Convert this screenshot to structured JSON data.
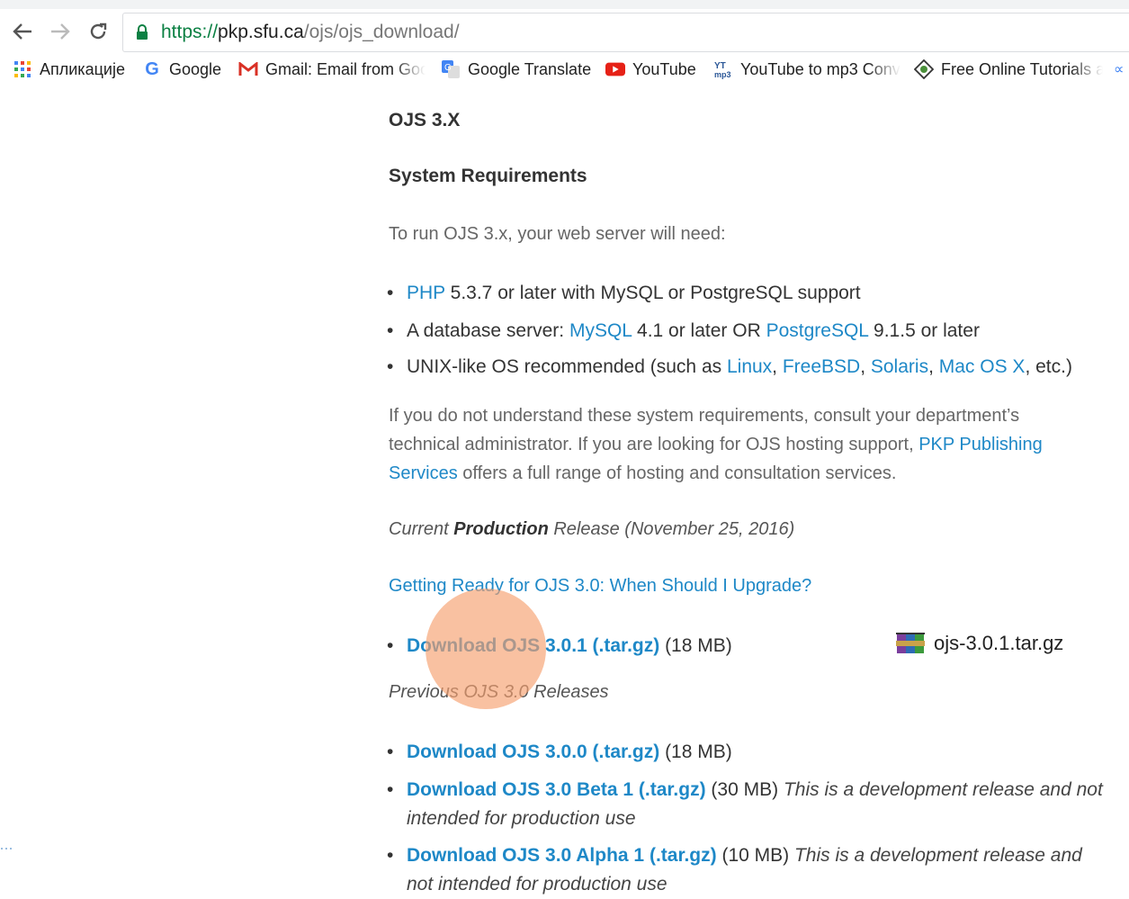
{
  "browser": {
    "url": {
      "scheme": "https://",
      "host": "pkp.sfu.ca",
      "path": "/ojs/ojs_download/"
    },
    "bookmarks": [
      {
        "label": "Апликације",
        "icon": "apps-grid-icon"
      },
      {
        "label": "Google",
        "icon": "google-g-icon"
      },
      {
        "label": "Gmail: Email from Goo",
        "icon": "gmail-icon"
      },
      {
        "label": "Google Translate",
        "icon": "google-translate-icon"
      },
      {
        "label": "YouTube",
        "icon": "youtube-icon"
      },
      {
        "label": "YouTube to mp3 Conv",
        "icon": "yt-mp3-icon"
      },
      {
        "label": "Free Online Tutorials a",
        "icon": "tutorials-icon"
      }
    ]
  },
  "page": {
    "section_title": "OJS 3.X",
    "requirements_title": "System Requirements",
    "intro": "To run OJS 3.x, your web server will need:",
    "requirements": {
      "php": {
        "link": "PHP",
        "text": " 5.3.7 or later with MySQL or PostgreSQL support"
      },
      "db": {
        "pre": "A database server: ",
        "link1": "MySQL",
        "mid": " 4.1 or later OR ",
        "link2": "PostgreSQL",
        "post": " 9.1.5 or later"
      },
      "os": {
        "pre": "UNIX-like OS recommended (such as ",
        "links": [
          "Linux",
          "FreeBSD",
          "Solaris",
          "Mac OS X"
        ],
        "sep": ", ",
        "post": ", etc.)"
      }
    },
    "consult": {
      "line1": "If you do not understand these system requirements, consult your department’s",
      "line2_pre": "technical administrator. If you are looking for OJS hosting support, ",
      "link_a": "PKP Publishing",
      "link_b": "Services",
      "line3_post": " offers a full range of hosting and consultation services."
    },
    "current_release": {
      "pre": "Current ",
      "bold": "Production",
      "post": " Release (November 25, 2016)"
    },
    "upgrade_link": "Getting Ready for OJS 3.0: When Should I Upgrade?",
    "current_download": {
      "link": "Download OJS 3.0.1 (.tar.gz)",
      "size": " (18 MB)"
    },
    "downloaded_file": {
      "name": "ojs-3.0.1.tar.gz",
      "icon": "winrar-archive-icon"
    },
    "previous_title": "Previous OJS 3.0 Releases",
    "previous": [
      {
        "link": "Download OJS 3.0.0 (.tar.gz)",
        "size": " (18 MB)",
        "note1": "",
        "note2": ""
      },
      {
        "link": "Download OJS 3.0 Beta 1 (.tar.gz)",
        "size": " (30 MB) ",
        "note1": "This is a development release and not",
        "note2": "intended for production use"
      },
      {
        "link": "Download OJS 3.0 Alpha 1 (.tar.gz)",
        "size": " (10 MB) ",
        "note1": "This is a development release and",
        "note2": "not intended for production use"
      }
    ]
  },
  "colors": {
    "link": "#1e88c7",
    "secure": "#0b8043",
    "highlight": "#f6a06e"
  }
}
